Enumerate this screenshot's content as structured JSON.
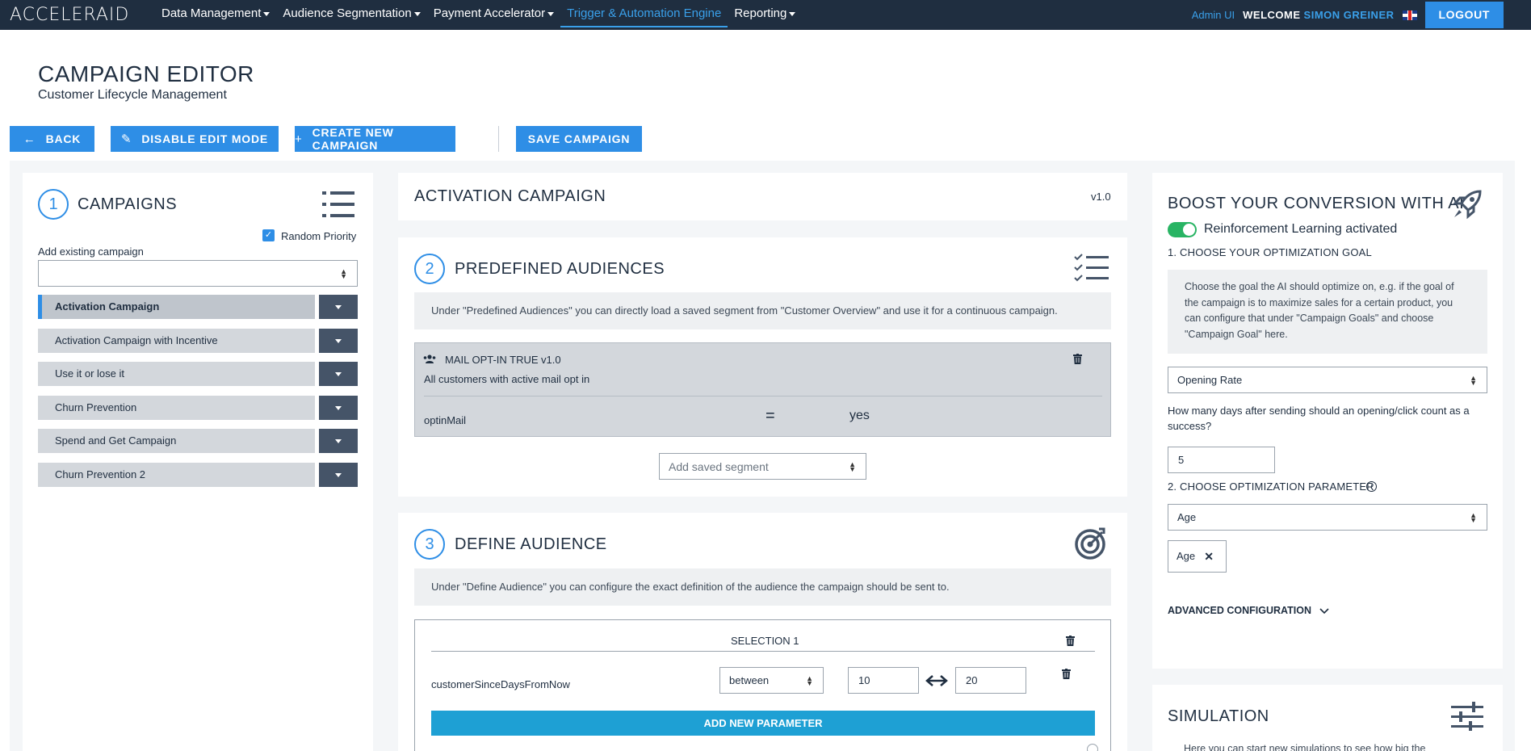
{
  "nav": {
    "logo": "ACCELERAID",
    "items": [
      {
        "label": "Data Management"
      },
      {
        "label": "Audience Segmentation"
      },
      {
        "label": "Payment Accelerator"
      },
      {
        "label": "Trigger & Automation Engine"
      },
      {
        "label": "Reporting"
      }
    ],
    "admin_link": "Admin UI",
    "welcome": "WELCOME",
    "user_name": "SIMON GREINER",
    "logout": "LOGOUT"
  },
  "header": {
    "title": "CAMPAIGN EDITOR",
    "subtitle": "Customer Lifecycle Management"
  },
  "toolbar": {
    "back": "BACK",
    "disable_edit": "DISABLE EDIT MODE",
    "create_new": "CREATE NEW CAMPAIGN",
    "save": "SAVE CAMPAIGN"
  },
  "campaigns_panel": {
    "step": "1",
    "title": "CAMPAIGNS",
    "random_priority_label": "Random Priority",
    "random_priority_checked": true,
    "add_existing_label": "Add existing campaign",
    "add_existing_value": "",
    "items": [
      {
        "label": "Activation Campaign",
        "active": true
      },
      {
        "label": "Activation Campaign with Incentive",
        "active": false
      },
      {
        "label": "Use it or lose it",
        "active": false
      },
      {
        "label": "Churn Prevention",
        "active": false
      },
      {
        "label": "Spend and Get Campaign",
        "active": false
      },
      {
        "label": "Churn Prevention 2",
        "active": false
      }
    ]
  },
  "campaign": {
    "name": "ACTIVATION CAMPAIGN",
    "version": "v1.0"
  },
  "predefined": {
    "step": "2",
    "title": "PREDEFINED AUDIENCES",
    "info": "Under \"Predefined Audiences\" you can directly load a saved segment from \"Customer Overview\" and use it for a continuous campaign.",
    "audience": {
      "name": "MAIL OPT-IN TRUE",
      "version": "v1.0",
      "description": "All customers with active mail opt in",
      "param": "optinMail",
      "operator": "=",
      "value": "yes"
    },
    "add_saved_placeholder": "Add saved segment"
  },
  "define": {
    "step": "3",
    "title": "DEFINE AUDIENCE",
    "info": "Under \"Define Audience\" you can configure the exact definition of the audience the campaign should be sent to.",
    "selection_title": "SELECTION 1",
    "param": "customerSinceDaysFromNow",
    "operator": "between",
    "from": "10",
    "to": "20",
    "add_param": "ADD NEW PARAMETER"
  },
  "ai": {
    "title": "BOOST YOUR CONVERSION WITH AI",
    "toggle_label": "Reinforcement Learning activated",
    "toggle_on": true,
    "goal_heading": "1. CHOOSE YOUR OPTIMIZATION GOAL",
    "goal_info_lines": [
      "Choose the goal the AI should optimize on, e.g. if the goal of",
      "the campaign is to maximize sales for a certain product, you",
      "can configure that under \"Campaign Goals\" and choose",
      "\"Campaign Goal\" here."
    ],
    "goal_value": "Opening Rate",
    "days_question_lines": [
      "How many days after sending should an opening/click count as a",
      "success?"
    ],
    "days_value": "5",
    "param_heading": "2. CHOOSE OPTIMIZATION PARAMETER",
    "param_value": "Age",
    "param_tag": "Age",
    "advanced": "ADVANCED CONFIGURATION"
  },
  "simulation": {
    "title": "SIMULATION",
    "info": "Here you can start new simulations to see how big the"
  },
  "colors": {
    "navbar": "#1f2e40",
    "accent": "#2e8ee6",
    "toggle": "#28b463",
    "add_param": "#1ea0d4"
  }
}
